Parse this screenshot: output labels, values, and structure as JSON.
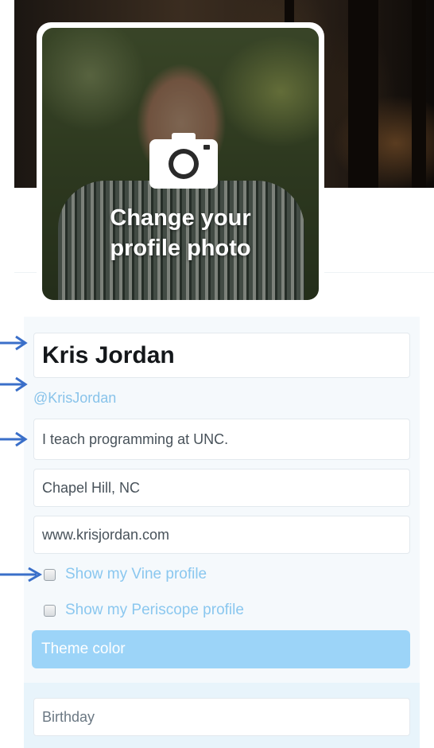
{
  "avatar": {
    "label_line1": "Change your",
    "label_line2": "profile photo",
    "icon": "camera-icon"
  },
  "profile": {
    "name": "Kris Jordan",
    "handle": "@KrisJordan",
    "bio": "I teach programming at UNC.",
    "location": "Chapel Hill, NC",
    "website": "www.krisjordan.com",
    "birthday_placeholder": "Birthday"
  },
  "options": {
    "vine_label": "Show my Vine profile",
    "periscope_label": "Show my Periscope profile",
    "vine_checked": false,
    "periscope_checked": false
  },
  "theme": {
    "label": "Theme color"
  },
  "colors": {
    "accent_light": "#9cd4f8",
    "link": "#8ac7ef",
    "annotation_arrow": "#3a6fc9"
  }
}
